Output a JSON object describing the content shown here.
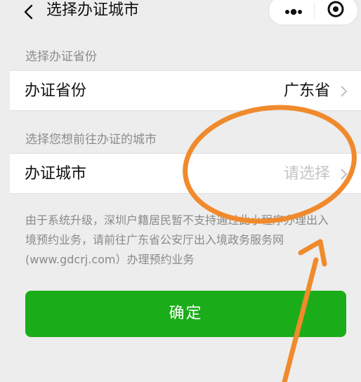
{
  "nav": {
    "title": "选择办证城市",
    "back_icon": "chevron-left-icon",
    "more_icon": "more-dots-icon",
    "close_icon": "target-circle-icon"
  },
  "province_section": {
    "label": "选择办证省份",
    "row_label": "办证省份",
    "row_value": "广东省"
  },
  "city_section": {
    "label": "选择您想前往办证的城市",
    "row_label": "办证城市",
    "row_placeholder": "请选择"
  },
  "notice": {
    "line1": "由于系统升级，深圳户籍居民暂不支持通过此小程序办理出入",
    "line2": "境预约业务，请前往广东省公安厅出入境政务服务网",
    "line3": "(www.gdcrj.com）办理预约业务"
  },
  "confirm_button": {
    "label": "确定",
    "color": "#1aad19"
  },
  "colors": {
    "background": "#ededed",
    "annotation_stroke": "#f08a2c",
    "placeholder": "#c4c4c4"
  }
}
